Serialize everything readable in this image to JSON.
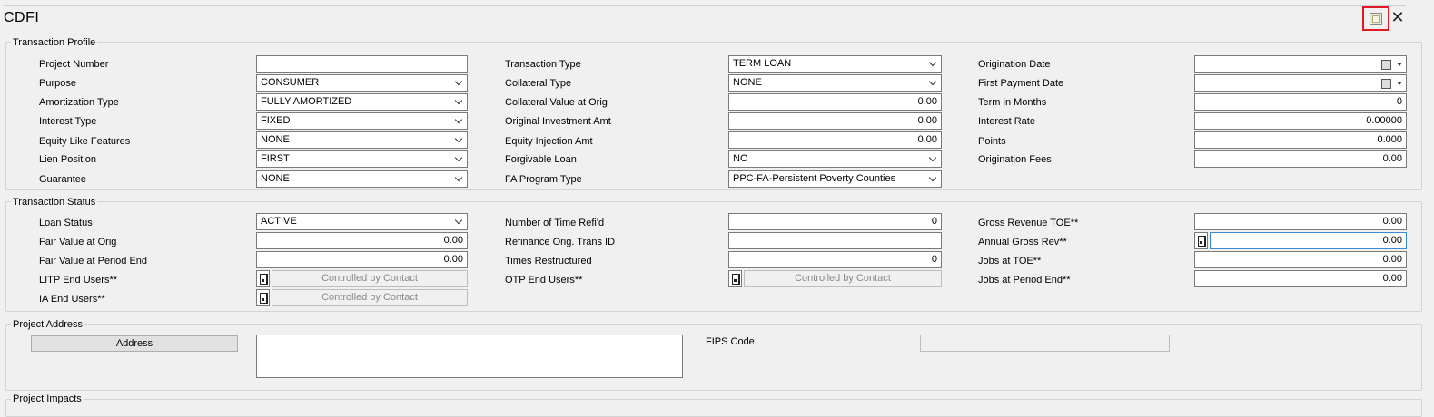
{
  "app": {
    "title": "CDFI"
  },
  "groups": {
    "transaction_profile": "Transaction Profile",
    "transaction_status": "Transaction Status",
    "project_address": "Project Address",
    "project_impacts": "Project Impacts"
  },
  "profile": {
    "project_number": {
      "label": "Project Number",
      "value": ""
    },
    "purpose": {
      "label": "Purpose",
      "value": "CONSUMER"
    },
    "amortization_type": {
      "label": "Amortization Type",
      "value": "FULLY AMORTIZED"
    },
    "interest_type": {
      "label": "Interest Type",
      "value": "FIXED"
    },
    "equity_like_features": {
      "label": "Equity Like Features",
      "value": "NONE"
    },
    "lien_position": {
      "label": "Lien Position",
      "value": "FIRST"
    },
    "guarantee": {
      "label": "Guarantee",
      "value": "NONE"
    },
    "transaction_type": {
      "label": "Transaction Type",
      "value": "TERM LOAN"
    },
    "collateral_type": {
      "label": "Collateral Type",
      "value": "NONE"
    },
    "collateral_value_at_orig": {
      "label": "Collateral Value at Orig",
      "value": "0.00"
    },
    "original_investment_amt": {
      "label": "Original Investment Amt",
      "value": "0.00"
    },
    "equity_injection_amt": {
      "label": "Equity Injection Amt",
      "value": "0.00"
    },
    "forgivable_loan": {
      "label": "Forgivable Loan",
      "value": "NO"
    },
    "fa_program_type": {
      "label": "FA Program Type",
      "value": "PPC-FA-Persistent Poverty Counties"
    },
    "origination_date": {
      "label": "Origination Date",
      "value": ""
    },
    "first_payment_date": {
      "label": "First Payment Date",
      "value": ""
    },
    "term_in_months": {
      "label": "Term in Months",
      "value": "0"
    },
    "interest_rate": {
      "label": "Interest Rate",
      "value": "0.00000"
    },
    "points": {
      "label": "Points",
      "value": "0.000"
    },
    "origination_fees": {
      "label": "Origination Fees",
      "value": "0.00"
    }
  },
  "status": {
    "loan_status": {
      "label": "Loan Status",
      "value": "ACTIVE"
    },
    "fair_value_at_orig": {
      "label": "Fair Value at Orig",
      "value": "0.00"
    },
    "fair_value_at_period_end": {
      "label": "Fair Value at Period End",
      "value": "0.00"
    },
    "litp_end_users": {
      "label": "LITP End Users**",
      "value": "Controlled by Contact"
    },
    "ia_end_users": {
      "label": "IA End Users**",
      "value": "Controlled by Contact"
    },
    "number_of_time_refid": {
      "label": "Number of Time Refi'd",
      "value": "0"
    },
    "refinance_orig_trans_id": {
      "label": "Refinance Orig. Trans ID",
      "value": ""
    },
    "times_restructured": {
      "label": "Times Restructured",
      "value": "0"
    },
    "otp_end_users": {
      "label": "OTP End Users**",
      "value": "Controlled by Contact"
    },
    "gross_revenue_toe": {
      "label": "Gross Revenue TOE**",
      "value": "0.00"
    },
    "annual_gross_rev": {
      "label": "Annual Gross Rev**",
      "value": "0.00"
    },
    "jobs_at_toe": {
      "label": "Jobs at TOE**",
      "value": "0.00"
    },
    "jobs_at_period_end": {
      "label": "Jobs at Period End**",
      "value": "0.00"
    }
  },
  "address": {
    "address_button": "Address",
    "address_value": "",
    "fips_label": "FIPS Code",
    "fips_value": ""
  },
  "icons": {
    "toolbar_icon": "form-icon",
    "close": "close-icon",
    "lookup": "document-lookup-icon",
    "calendar": "calendar-icon"
  },
  "colors": {
    "highlight": "#e01a22",
    "focus": "#3b8ad8",
    "background": "#f0f0f0"
  }
}
